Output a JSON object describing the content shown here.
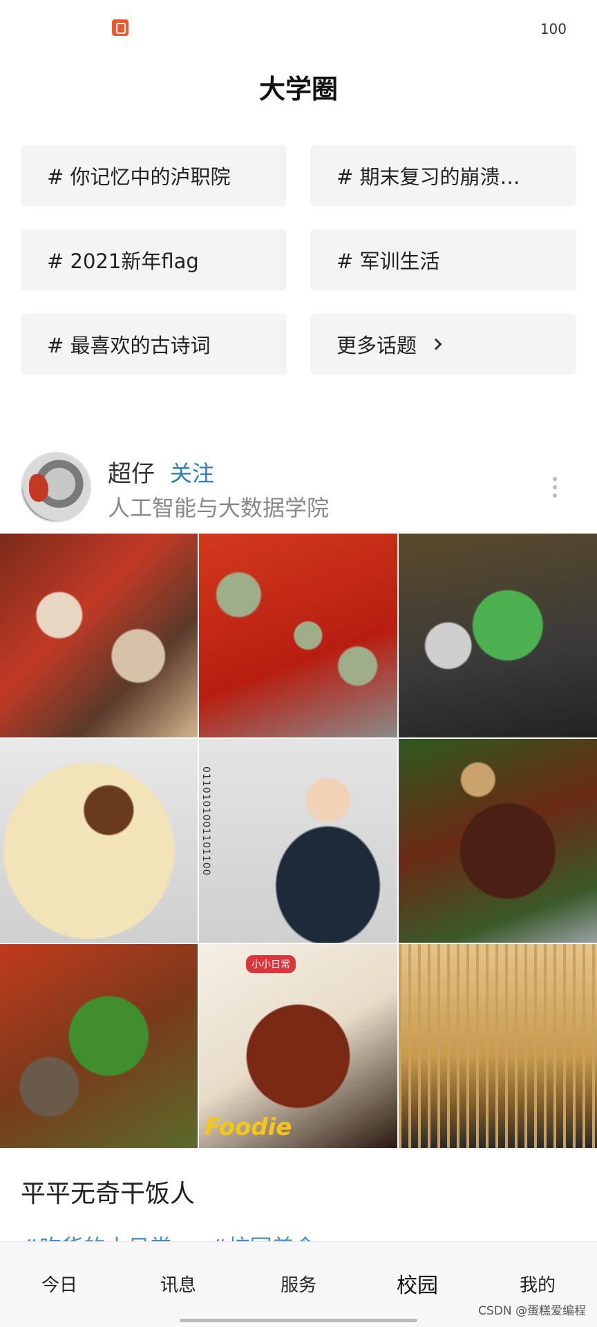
{
  "status": {
    "battery": "100"
  },
  "page": {
    "title": "大学圈"
  },
  "topics": [
    {
      "label": "# 你记忆中的泸职院"
    },
    {
      "label": "# 期末复习的崩溃…"
    },
    {
      "label": "# 2021新年flag"
    },
    {
      "label": "# 军训生活"
    },
    {
      "label": "# 最喜欢的古诗词"
    },
    {
      "label": "更多话题"
    }
  ],
  "post": {
    "username": "超仔",
    "follow_label": "关注",
    "college": "人工智能与大数据学院",
    "photo_texts": {
      "foodie": "Foodie",
      "sticker": "小小日常"
    },
    "text": "平平无奇干饭人",
    "tags": [
      "#吃货的小日常",
      "#校园美食"
    ]
  },
  "tabs": [
    {
      "label": "今日"
    },
    {
      "label": "讯息"
    },
    {
      "label": "服务"
    },
    {
      "label": "校园"
    },
    {
      "label": "我的"
    }
  ],
  "watermark": "CSDN @蛋糕爱编程",
  "colors": {
    "accent_blue": "#2d7fb8",
    "tag_blue": "#4a8bc2",
    "app_badge": "#f0572a"
  }
}
